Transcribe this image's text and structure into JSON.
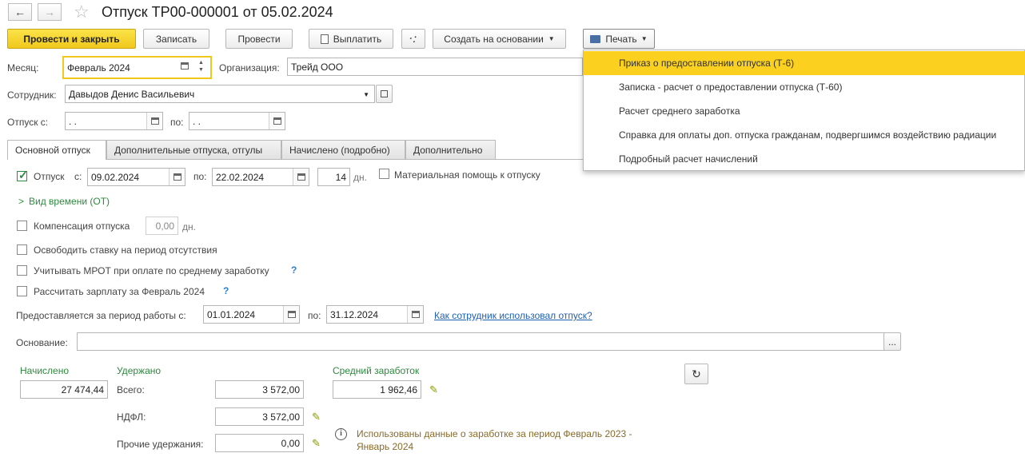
{
  "window": {
    "title": "Отпуск ТР00-000001 от 05.02.2024"
  },
  "toolbar": {
    "post_close": "Провести и закрыть",
    "save": "Записать",
    "post": "Провести",
    "pay": "Выплатить",
    "create_based": "Создать на основании",
    "print": "Печать"
  },
  "print_menu": {
    "items": [
      "Приказ о предоставлении отпуска (Т-6)",
      "Записка - расчет о предоставлении отпуска (Т-60)",
      "Расчет среднего заработка",
      "Справка для оплаты доп. отпуска гражданам, подвергшимся воздействию радиации",
      "Подробный расчет начислений"
    ]
  },
  "header": {
    "month_label": "Месяц:",
    "month_value": "Февраль 2024",
    "org_label": "Организация:",
    "org_value": "Трейд ООО",
    "employee_label": "Сотрудник:",
    "employee_value": "Давыдов Денис Васильевич",
    "leave_from_label": "Отпуск с:",
    "leave_from_value": " .  .",
    "leave_to_label": "по:",
    "leave_to_value": " .  ."
  },
  "tabs": [
    "Основной отпуск",
    "Дополнительные отпуска, отгулы",
    "Начислено (подробно)",
    "Дополнительно"
  ],
  "main": {
    "leave_checkbox": "Отпуск",
    "from_label": "с:",
    "from_value": "09.02.2024",
    "to_label": "по:",
    "to_value": "22.02.2024",
    "days_value": "14",
    "days_unit": "дн.",
    "material_help": "Материальная помощь к отпуску",
    "time_type": "Вид времени (ОТ)",
    "compensation_label": "Компенсация отпуска",
    "compensation_value": "0,00",
    "compensation_unit": "дн.",
    "free_rate": "Освободить ставку на период отсутствия",
    "mrot": "Учитывать МРОТ при оплате по среднему заработку",
    "calc_salary": "Рассчитать зарплату за Февраль 2024",
    "period_label": "Предоставляется за период работы с:",
    "period_from": "01.01.2024",
    "period_to_label": "по:",
    "period_to": "31.12.2024",
    "usage_link": "Как сотрудник использовал отпуск?",
    "basis_label": "Основание:",
    "basis_value": "",
    "qmark": "?"
  },
  "totals": {
    "accrued_label": "Начислено",
    "accrued_value": "27 474,44",
    "withheld_label": "Удержано",
    "total_label": "Всего:",
    "total_value": "3 572,00",
    "ndfl_label": "НДФЛ:",
    "ndfl_value": "3 572,00",
    "other_label": "Прочие удержания:",
    "other_value": "0,00",
    "avg_label": "Средний заработок",
    "avg_value": "1 962,46",
    "info_text": "Использованы данные о заработке за период Февраль 2023 - Январь 2024"
  },
  "colors": {
    "accent_yellow": "#f0c81c",
    "green": "#2d8a3e",
    "link": "#1f5fb3"
  }
}
